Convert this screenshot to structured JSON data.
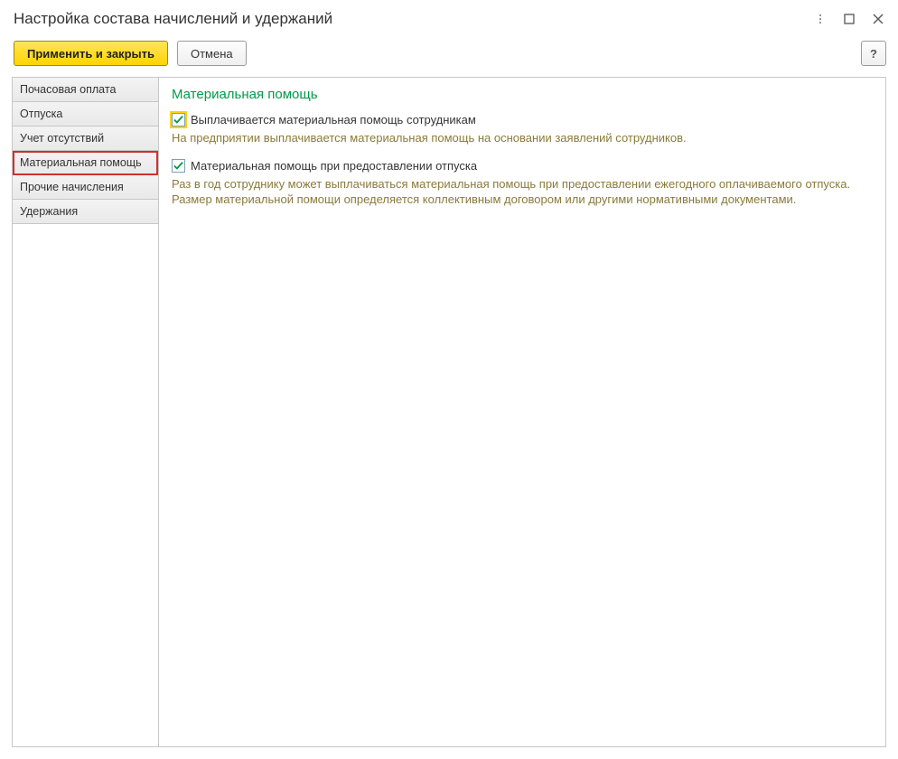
{
  "window": {
    "title": "Настройка состава начислений и удержаний"
  },
  "toolbar": {
    "apply_close": "Применить и закрыть",
    "cancel": "Отмена",
    "help": "?"
  },
  "sidebar": {
    "items": [
      "Почасовая оплата",
      "Отпуска",
      "Учет отсутствий",
      "Материальная помощь",
      "Прочие начисления",
      "Удержания"
    ],
    "selected_index": 3
  },
  "content": {
    "title": "Материальная помощь",
    "options": [
      {
        "checked": true,
        "highlight": true,
        "label": "Выплачивается материальная помощь сотрудникам",
        "description": "На предприятии выплачивается материальная помощь на основании заявлений сотрудников."
      },
      {
        "checked": true,
        "highlight": false,
        "label": "Материальная помощь при предоставлении отпуска",
        "description": "Раз в год сотруднику может выплачиваться материальная помощь при предоставлении ежегодного оплачиваемого отпуска. Размер материальной помощи определяется коллективным договором или другими нормативными документами."
      }
    ]
  }
}
